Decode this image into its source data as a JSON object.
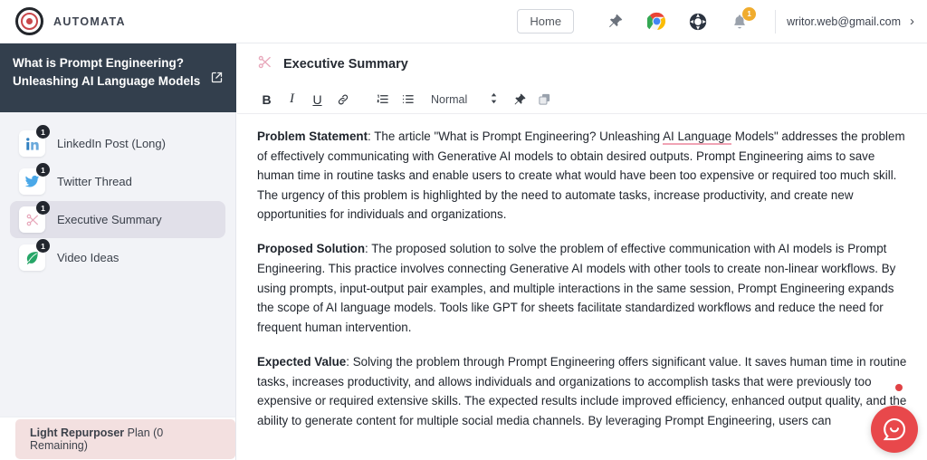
{
  "brand": {
    "name": "AUTOMATA",
    "logo_icon": "bullseye-logo-icon",
    "accent": "#c9474a"
  },
  "topbar": {
    "home_label": "Home",
    "icons": [
      {
        "name": "pin-icon"
      },
      {
        "name": "chrome-extension-icon"
      },
      {
        "name": "lifebuoy-help-icon"
      }
    ],
    "notification": {
      "icon": "bell-icon",
      "count": "1",
      "badge_color": "#f0ac2e"
    },
    "user_email": "writor.web@gmail.com",
    "chevron": "›"
  },
  "sidebar": {
    "document_title": "What is Prompt Engineering? Unleashing AI Language Models",
    "external_link_icon": "external-link-icon",
    "items": [
      {
        "label": "LinkedIn Post (Long)",
        "icon": "linkedin-icon",
        "badge": "1",
        "active": false
      },
      {
        "label": "Twitter Thread",
        "icon": "twitter-icon",
        "badge": "1",
        "active": false
      },
      {
        "label": "Executive Summary",
        "icon": "scissors-icon",
        "badge": "1",
        "active": true
      },
      {
        "label": "Video Ideas",
        "icon": "leaf-icon",
        "badge": "1",
        "active": false
      }
    ],
    "plan": {
      "name": "Light Repurposer",
      "suffix": " Plan (0 Remaining)",
      "bg": "#f3e0e0"
    }
  },
  "editor": {
    "title": "Executive Summary",
    "title_icon": "scissors-icon",
    "toolbar": {
      "bold": "B",
      "italic": "I",
      "underline": "U",
      "link_icon": "link-icon",
      "ordered_list_icon": "ordered-list-icon",
      "bullet_list_icon": "bullet-list-icon",
      "style_value": "Normal",
      "style_chevron_icon": "updown-chevron-icon",
      "pin_icon": "pin-icon",
      "copy_icon": "copy-icon"
    },
    "paragraphs": [
      {
        "heading": "Problem Statement",
        "body_before": ": The article \"What is Prompt Engineering? Unleashing ",
        "spellcheck": "AI Language",
        "body_after": " Models\" addresses the problem of effectively communicating with Generative AI models to obtain desired outputs. Prompt Engineering aims to save human time in routine tasks and enable users to create what would have been too expensive or required too much skill. The urgency of this problem is highlighted by the need to automate tasks, increase productivity, and create new opportunities for individuals and organizations."
      },
      {
        "heading": "Proposed Solution",
        "body_before": ": The proposed solution to solve the problem of effective communication with AI models is Prompt Engineering. This practice involves connecting Generative AI models with other tools to create non-linear workflows. By using prompts, input-output pair examples, and multiple interactions in the same session, Prompt Engineering expands the scope of AI language models. Tools like GPT for sheets facilitate standardized workflows and reduce the need for frequent human intervention.",
        "spellcheck": "",
        "body_after": ""
      },
      {
        "heading": "Expected Value",
        "body_before": ": Solving the problem through Prompt Engineering offers significant value. It saves human time in routine tasks, increases productivity, and allows individuals and organizations to accomplish tasks that were previously too expensive or required extensive skills. The expected results include improved efficiency, enhanced output quality, and the ability to generate content for multiple social media channels. By leveraging Prompt Engineering, users can",
        "spellcheck": "",
        "body_after": ""
      }
    ]
  },
  "chat_widget": {
    "icon": "chat-bubble-icon",
    "color": "#e8484b",
    "unread_dot": true
  }
}
